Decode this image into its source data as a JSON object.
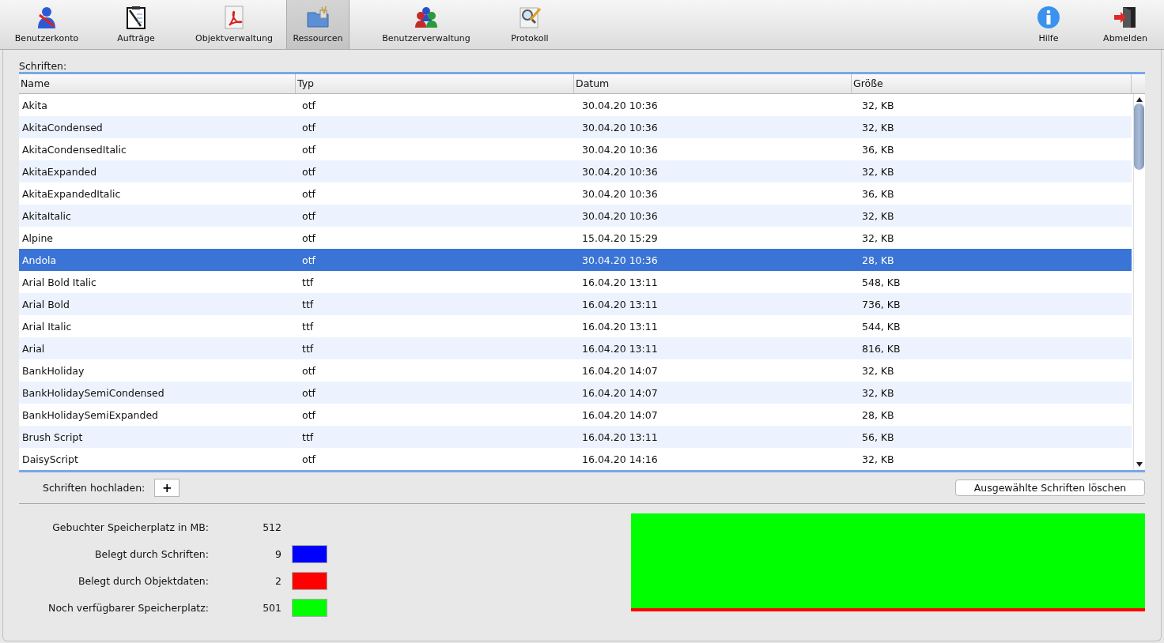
{
  "toolbar": [
    {
      "label": "Benutzerkonto",
      "selected": false
    },
    {
      "label": "Aufträge",
      "selected": false
    },
    {
      "label": "Objektverwaltung",
      "selected": false
    },
    {
      "label": "Ressourcen",
      "selected": true
    },
    {
      "label": "Benutzerverwaltung",
      "selected": false
    },
    {
      "label": "Protokoll",
      "selected": false
    },
    {
      "label": "Hilfe",
      "selected": false
    },
    {
      "label": "Abmelden",
      "selected": false
    }
  ],
  "fonts": {
    "title": "Schriften:",
    "columns": [
      "Name",
      "Typ",
      "Datum",
      "Größe"
    ],
    "rows": [
      {
        "cells": [
          "Akita",
          "otf",
          "30.04.20 10:36",
          "32, KB"
        ],
        "selected": false
      },
      {
        "cells": [
          "AkitaCondensed",
          "otf",
          "30.04.20 10:36",
          "32, KB"
        ],
        "selected": false
      },
      {
        "cells": [
          "AkitaCondensedItalic",
          "otf",
          "30.04.20 10:36",
          "36, KB"
        ],
        "selected": false
      },
      {
        "cells": [
          "AkitaExpanded",
          "otf",
          "30.04.20 10:36",
          "32, KB"
        ],
        "selected": false
      },
      {
        "cells": [
          "AkitaExpandedItalic",
          "otf",
          "30.04.20 10:36",
          "36, KB"
        ],
        "selected": false
      },
      {
        "cells": [
          "AkitaItalic",
          "otf",
          "30.04.20 10:36",
          "32, KB"
        ],
        "selected": false
      },
      {
        "cells": [
          "Alpine",
          "otf",
          "15.04.20 15:29",
          "32, KB"
        ],
        "selected": false
      },
      {
        "cells": [
          "Andola",
          "otf",
          "30.04.20 10:36",
          "28, KB"
        ],
        "selected": true
      },
      {
        "cells": [
          "Arial Bold Italic",
          "ttf",
          "16.04.20 13:11",
          "548, KB"
        ],
        "selected": false
      },
      {
        "cells": [
          "Arial Bold",
          "ttf",
          "16.04.20 13:11",
          "736, KB"
        ],
        "selected": false
      },
      {
        "cells": [
          "Arial Italic",
          "ttf",
          "16.04.20 13:11",
          "544, KB"
        ],
        "selected": false
      },
      {
        "cells": [
          "Arial",
          "ttf",
          "16.04.20 13:11",
          "816, KB"
        ],
        "selected": false
      },
      {
        "cells": [
          "BankHoliday",
          "otf",
          "16.04.20 14:07",
          "32, KB"
        ],
        "selected": false
      },
      {
        "cells": [
          "BankHolidaySemiCondensed",
          "otf",
          "16.04.20 14:07",
          "32, KB"
        ],
        "selected": false
      },
      {
        "cells": [
          "BankHolidaySemiExpanded",
          "otf",
          "16.04.20 14:07",
          "28, KB"
        ],
        "selected": false
      },
      {
        "cells": [
          "Brush Script",
          "ttf",
          "16.04.20 13:11",
          "56, KB"
        ],
        "selected": false
      },
      {
        "cells": [
          "DaisyScript",
          "otf",
          "16.04.20 14:16",
          "32, KB"
        ],
        "selected": false
      }
    ],
    "upload_label": "Schriften hochladen:",
    "upload_button": "+",
    "delete_button": "Ausgewählte Schriften löschen"
  },
  "storage": [
    {
      "label": "Gebuchter Speicherplatz in MB:",
      "value": "512"
    },
    {
      "label": "Belegt durch Schriften:",
      "value": "9",
      "color": "#0000ff"
    },
    {
      "label": "Belegt durch Objektdaten:",
      "value": "2",
      "color": "#ff0000"
    },
    {
      "label": "Noch verfügbarer Speicherplatz:",
      "value": "501",
      "color": "#00ff00"
    }
  ]
}
